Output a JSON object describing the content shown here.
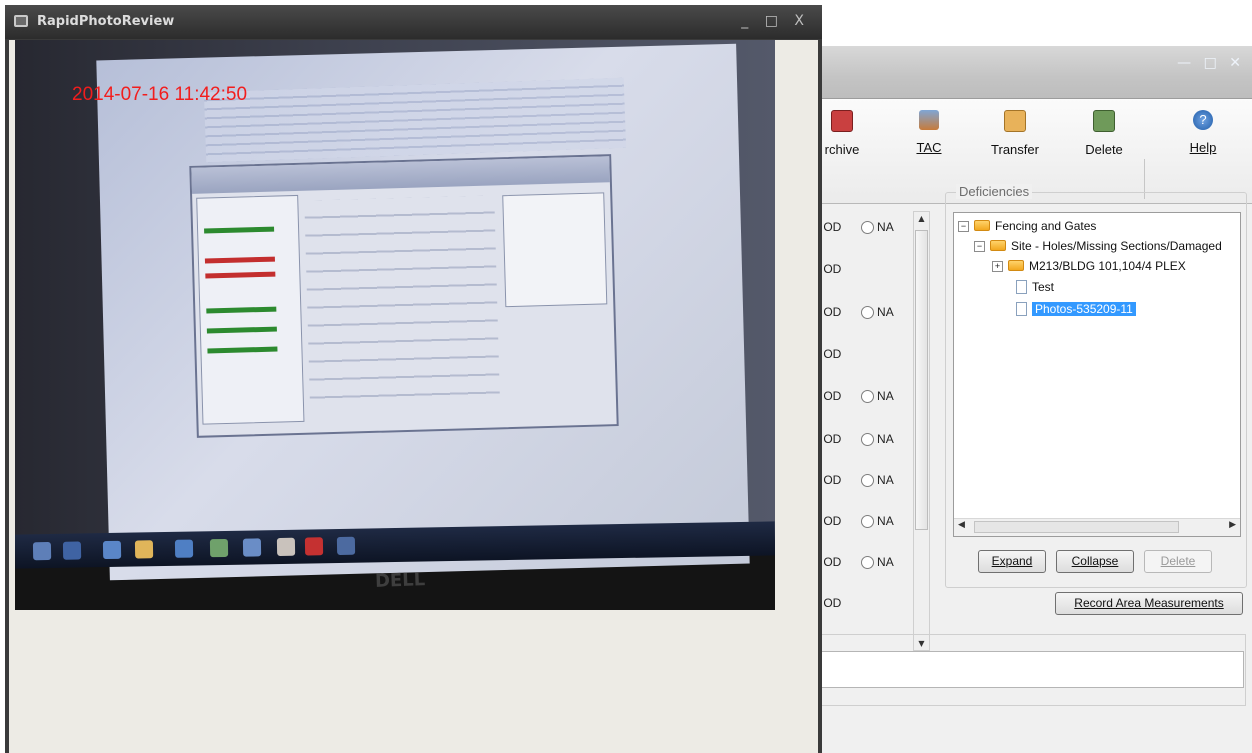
{
  "background_app": {
    "toolbar": {
      "archive": "rchive",
      "tac": "TAC",
      "transfer": "Transfer",
      "delete": "Delete",
      "help": "Help"
    },
    "radio_rows": [
      {
        "od": "OD",
        "na": "NA",
        "selected": "OD"
      },
      {
        "od": "OD"
      },
      {
        "od": "OD",
        "na": "NA"
      },
      {
        "od": "OD"
      },
      {
        "od": "OD",
        "na": "NA"
      },
      {
        "od": "OD",
        "na": "NA"
      },
      {
        "od": "OD",
        "na": "NA"
      },
      {
        "od": "OD",
        "na": "NA"
      },
      {
        "od": "OD",
        "na": "NA"
      },
      {
        "od": "OD"
      }
    ],
    "deficiencies": {
      "title": "Deficiencies",
      "tree": [
        {
          "label": "Fencing and Gates",
          "expander": "−"
        },
        {
          "label": "Site - Holes/Missing Sections/Damaged",
          "expander": "−"
        },
        {
          "label": "M213/BLDG 101,104/4 PLEX",
          "expander": "+"
        },
        {
          "label": "Test"
        },
        {
          "label": "Photos-535209-11"
        }
      ],
      "buttons": {
        "expand": "Expand",
        "collapse": "Collapse",
        "delete": "Delete"
      }
    },
    "record_button": "Record Area Measurements"
  },
  "camera_window": {
    "title": "RapidPhotoReview",
    "controls": "_ □ X",
    "timestamp": "2014-07-16 11:42:50",
    "monitor_brand": "DELL"
  },
  "colors": {
    "timestamp": "#f21d1d",
    "selection": "#3399ff",
    "camera_chrome": "#3a3a3a"
  }
}
